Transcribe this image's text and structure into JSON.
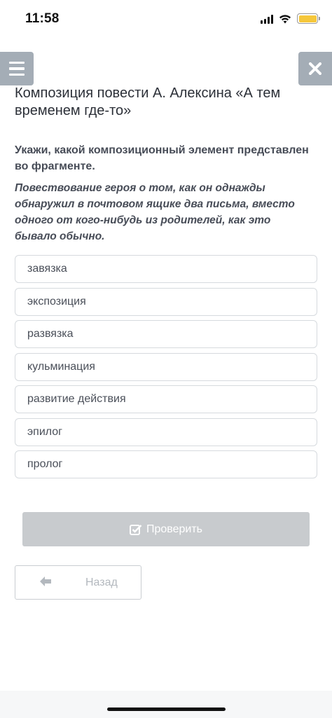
{
  "status_bar": {
    "time": "11:58",
    "icons": [
      "signal-icon",
      "wifi-icon",
      "battery-icon"
    ],
    "battery_color": "#f5c73b"
  },
  "nav": {
    "menu_icon": "hamburger-menu-icon",
    "close_icon": "close-icon",
    "button_color": "#a4adb6"
  },
  "page": {
    "title": "Композиция повести А. Алексина «А тем временем где-то»"
  },
  "question": {
    "prompt": "Укажи, какой композиционный элемент представлен во фрагменте.",
    "fragment": "Повествование героя о том, как он однажды обнаружил в почтовом ящике два письма, вместо одного от кого-нибудь из родителей, как это бывало обычно."
  },
  "options": [
    {
      "label": "завязка"
    },
    {
      "label": "экспозиция"
    },
    {
      "label": "развязка"
    },
    {
      "label": "кульминация"
    },
    {
      "label": "развитие действия"
    },
    {
      "label": "эпилог"
    },
    {
      "label": "пролог"
    }
  ],
  "actions": {
    "check_label": "Проверить",
    "check_icon": "checkbox-check-icon",
    "back_label": "Назад",
    "back_icon": "arrow-left-icon",
    "check_color": "#c8cbce"
  }
}
